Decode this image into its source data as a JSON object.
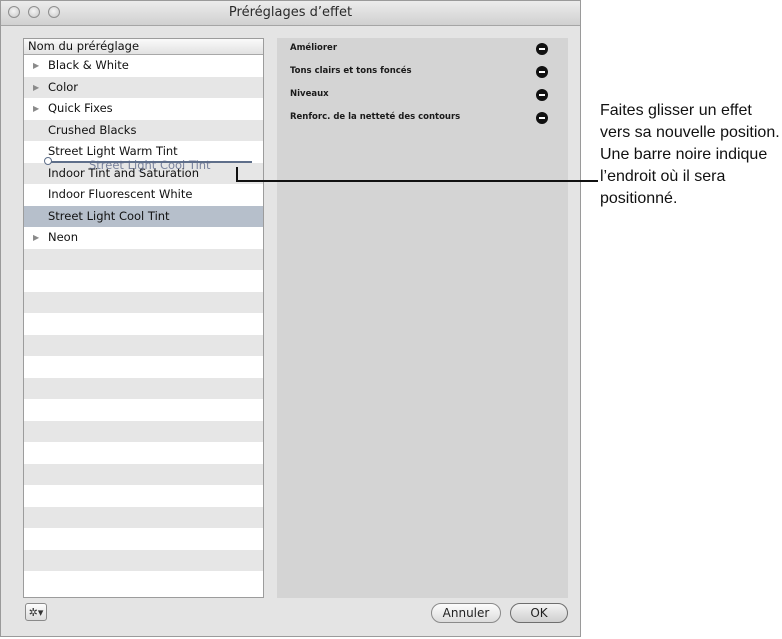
{
  "window": {
    "title": "Préréglages d’effet",
    "traffic_lights": [
      "close-button",
      "minimize-button",
      "zoom-button"
    ]
  },
  "preset_list": {
    "header": "Nom du préréglage",
    "items": [
      {
        "label": "Black & White",
        "disclosure": true,
        "selected": false
      },
      {
        "label": "Color",
        "disclosure": true,
        "selected": false
      },
      {
        "label": "Quick Fixes",
        "disclosure": true,
        "selected": false
      },
      {
        "label": "Crushed Blacks",
        "disclosure": false,
        "selected": false
      },
      {
        "label": "Street Light Warm Tint",
        "disclosure": false,
        "selected": false
      },
      {
        "label": "Indoor Tint and Saturation",
        "disclosure": false,
        "selected": false
      },
      {
        "label": "Indoor Fluorescent White",
        "disclosure": false,
        "selected": false
      },
      {
        "label": "Street Light Cool Tint",
        "disclosure": false,
        "selected": true
      },
      {
        "label": "Neon",
        "disclosure": true,
        "selected": false
      }
    ],
    "drag_ghost_label": "Street Light Cool Tint"
  },
  "effects": [
    {
      "label": "Améliorer"
    },
    {
      "label": "Tons clairs et tons foncés"
    },
    {
      "label": "Niveaux"
    },
    {
      "label": "Renforc. de la netteté des contours"
    }
  ],
  "footer": {
    "gear_icon": "gear-icon",
    "cancel_label": "Annuler",
    "ok_label": "OK"
  },
  "callout": {
    "text": "Faites glisser un effet vers sa nouvelle position. Une barre noire indique l’endroit où il sera positionné."
  },
  "colors": {
    "selection": "#b6bfcb",
    "stripe": "#e6e6e6",
    "panel": "#d4d4d4",
    "drop_indicator": "#5f6f8a"
  }
}
